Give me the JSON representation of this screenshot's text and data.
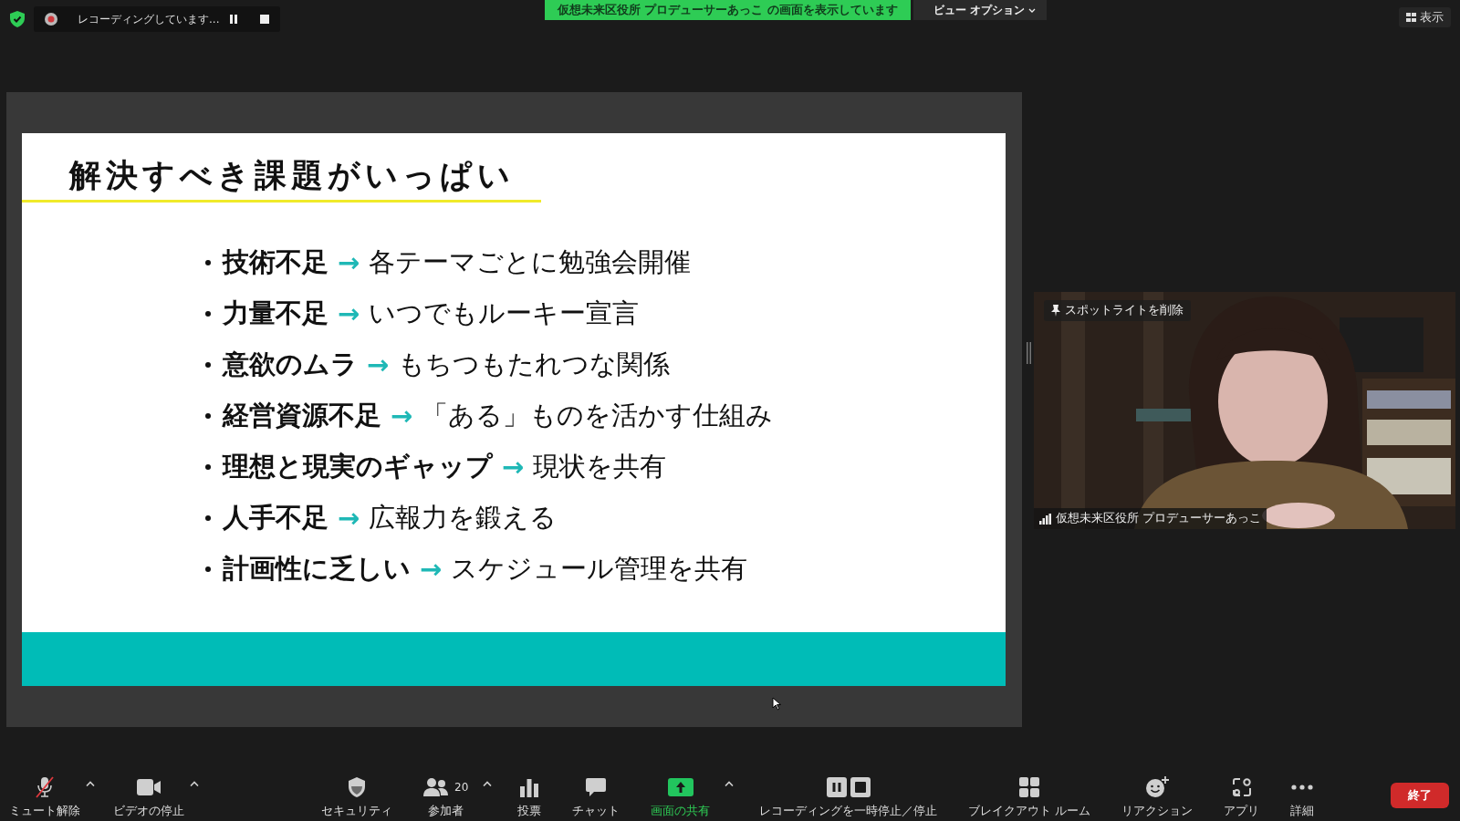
{
  "topbar": {
    "recording": "レコーディングしています...",
    "banner": "仮想未来区役所 プロデューサーあっこ の画面を表示しています",
    "view_options": "ビュー オプション",
    "view_button": "表示"
  },
  "slide": {
    "title": "解決すべき課題がいっぱい",
    "items": [
      {
        "term": "技術不足",
        "arrow": "→",
        "result": "各テーマごとに勉強会開催"
      },
      {
        "term": "力量不足",
        "arrow": "→",
        "result": "いつでもルーキー宣言"
      },
      {
        "term": "意欲のムラ",
        "arrow": "→",
        "result": "もちつもたれつな関係"
      },
      {
        "term": "経営資源不足",
        "arrow": "→",
        "result": "「ある」ものを活かす仕組み"
      },
      {
        "term": "理想と現実のギャップ",
        "arrow": "→",
        "result": "現状を共有"
      },
      {
        "term": "人手不足",
        "arrow": "→",
        "result": "広報力を鍛える"
      },
      {
        "term": "計画性に乏しい",
        "arrow": "→",
        "result": "スケジュール管理を共有"
      }
    ]
  },
  "video": {
    "kind": "picture",
    "spotlight": "スポットライトを削除",
    "name": "仮想未来区役所 プロデューサーあっこ"
  },
  "toolbar": {
    "audio": {
      "label": "ミュート解除",
      "muted": true
    },
    "video": {
      "label": "ビデオの停止"
    },
    "tools": [
      {
        "kind": "security",
        "label": "セキュリティ",
        "caret": false,
        "highlighted": false
      },
      {
        "kind": "participants",
        "label": "参加者",
        "count": "20",
        "caret": true,
        "highlighted": false
      },
      {
        "kind": "polls",
        "label": "投票",
        "caret": false,
        "highlighted": false
      },
      {
        "kind": "chat",
        "label": "チャット",
        "caret": false,
        "highlighted": false
      },
      {
        "kind": "share",
        "label": "画面の共有",
        "caret": true,
        "highlighted": true
      },
      {
        "kind": "recording",
        "label": "レコーディングを一時停止／停止",
        "caret": false,
        "highlighted": false
      },
      {
        "kind": "breakout",
        "label": "ブレイクアウト ルーム",
        "caret": false,
        "highlighted": false
      },
      {
        "kind": "reactions",
        "label": "リアクション",
        "caret": false,
        "highlighted": false
      },
      {
        "kind": "apps",
        "label": "アプリ",
        "caret": false,
        "highlighted": false
      },
      {
        "kind": "more",
        "label": "詳細",
        "caret": false,
        "highlighted": false
      }
    ],
    "end": "終了"
  }
}
